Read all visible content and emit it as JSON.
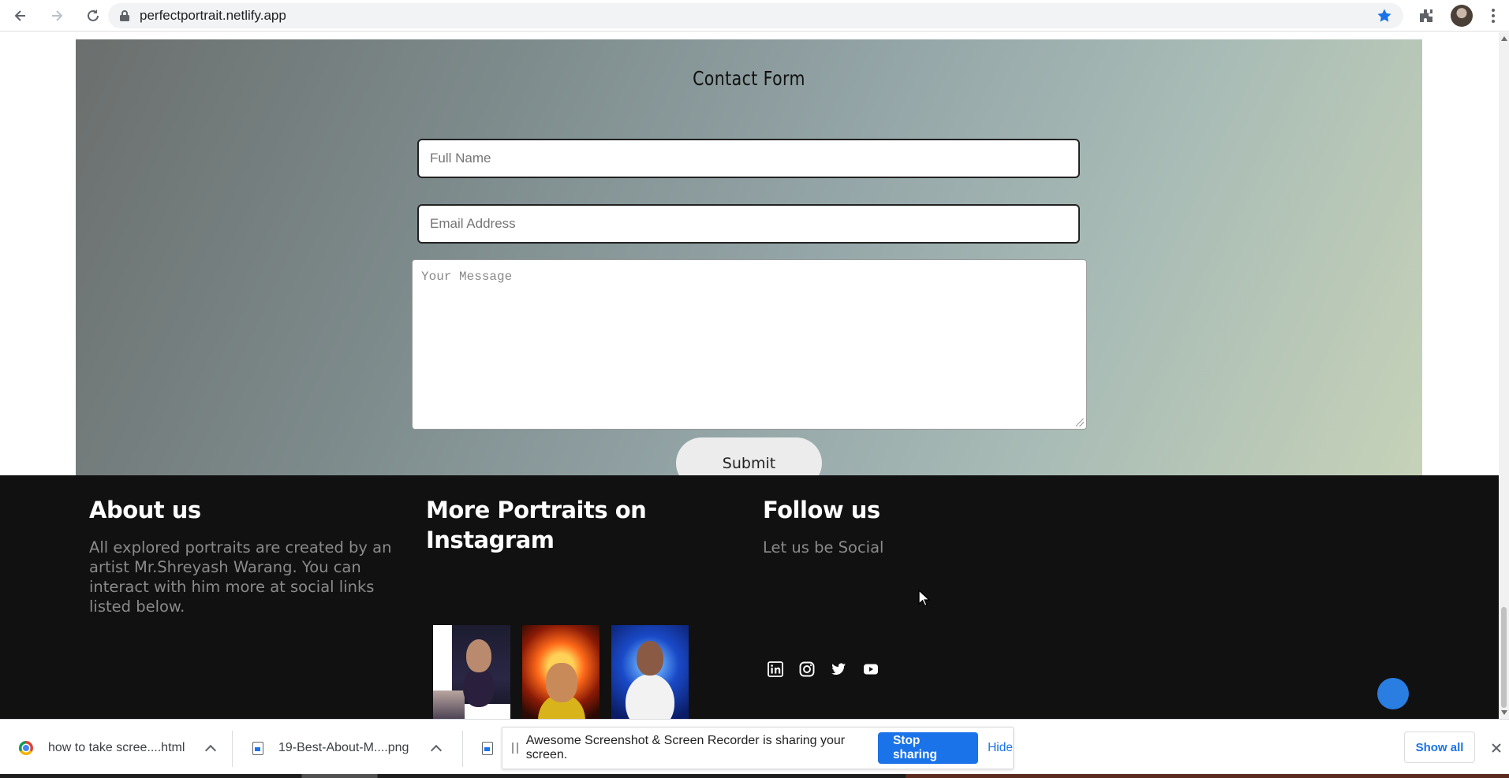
{
  "browser": {
    "url": "perfectportrait.netlify.app",
    "back_icon": "back-arrow-icon",
    "forward_icon": "forward-arrow-icon",
    "reload_icon": "reload-icon"
  },
  "contact": {
    "title": "Contact Form",
    "name_placeholder": "Full Name",
    "email_placeholder": "Email Address",
    "message_placeholder": "Your Message",
    "submit_label": "Submit"
  },
  "footer": {
    "about_title": "About us",
    "about_text": "All explored portraits are created by an artist Mr.Shreyash Warang. You can interact with him more at social links listed below.",
    "instagram_title": "More Portraits on Instagram",
    "follow_title": "Follow us",
    "follow_text": "Let us be Social",
    "socials": [
      "linkedin-icon",
      "instagram-icon",
      "twitter-icon",
      "youtube-icon"
    ]
  },
  "downloads": {
    "items": [
      {
        "label": "how to take scree....html"
      },
      {
        "label": "19-Best-About-M....png"
      }
    ],
    "share_message": "Awesome Screenshot & Screen Recorder is sharing your screen.",
    "stop_sharing_label": "Stop sharing",
    "hide_label": "Hide",
    "show_all_label": "Show all"
  },
  "colors": {
    "accent": "#1a73e8",
    "footer_bg": "#111111",
    "footer_text": "#8a8a8a"
  }
}
